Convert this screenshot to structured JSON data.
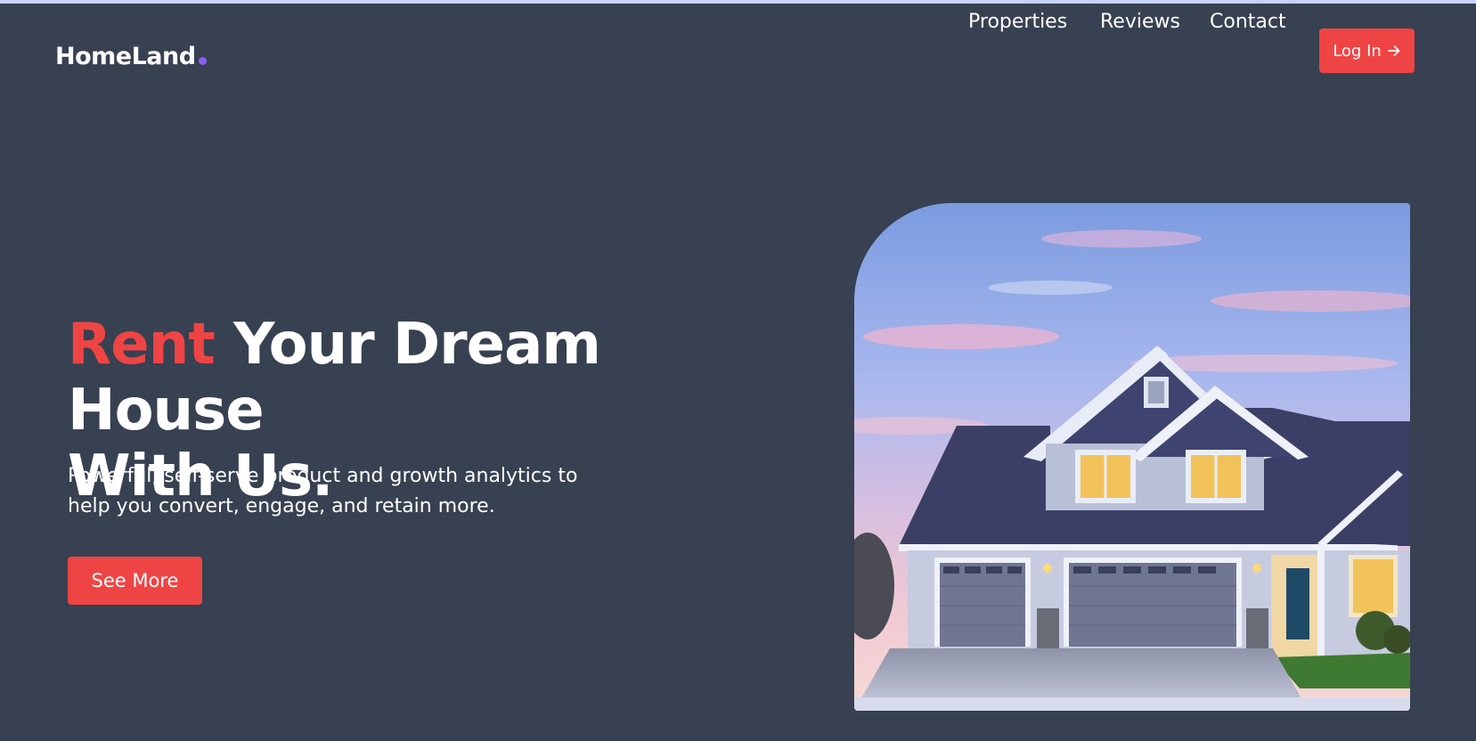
{
  "colors": {
    "background": "#374151",
    "accent": "#ef4444",
    "logo_dot": "#8b5cf6",
    "text": "#ffffff"
  },
  "header": {
    "logo_text": "HomeLand",
    "nav": [
      {
        "label": "Properties"
      },
      {
        "label": "Reviews"
      },
      {
        "label": "Contact"
      }
    ],
    "login_label": "Log In",
    "login_icon": "arrow-right-icon"
  },
  "hero": {
    "title_highlight": "Rent",
    "title_rest": " Your Dream House",
    "title_line2": "With Us.",
    "subtitle": "Powerful, self-serve product and growth analytics to help you convert, engage, and retain more.",
    "cta_label": "See More",
    "image_subject": "house-photo"
  }
}
